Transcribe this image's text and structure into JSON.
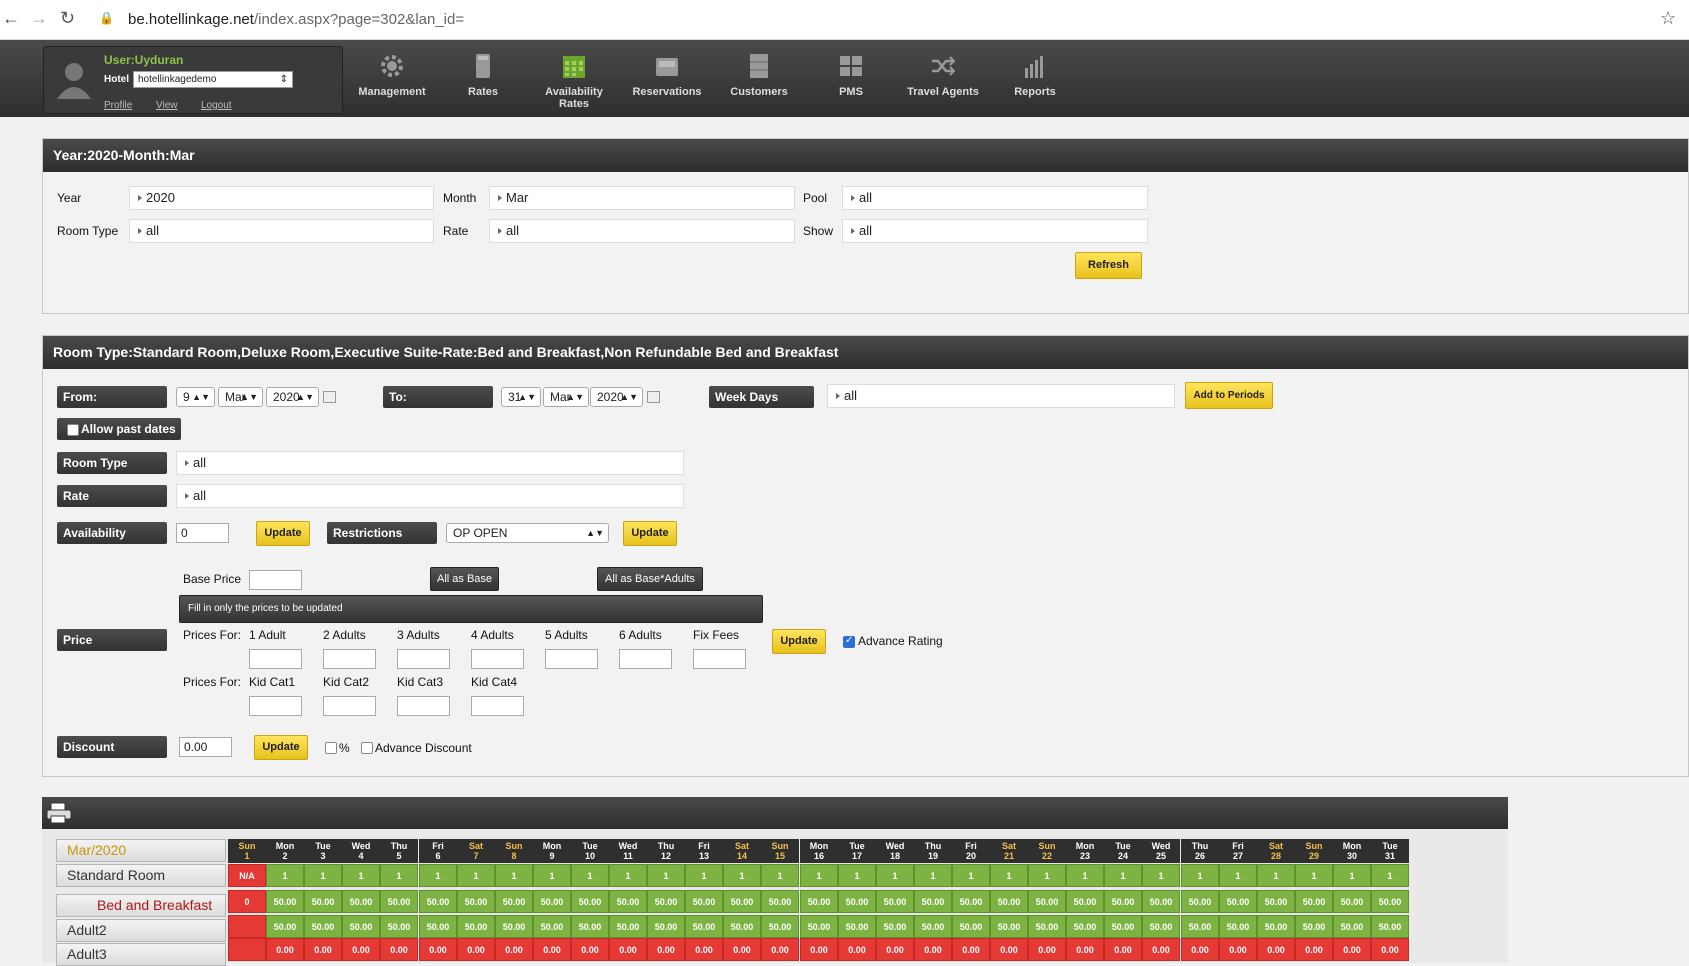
{
  "browser": {
    "url_host": "be.hotellinkage.net",
    "url_path": "/index.aspx?page=302&lan_id="
  },
  "user": {
    "name": "User:Uyduran",
    "hotel_label": "Hotel",
    "hotel_value": "hotellinkagedemo",
    "links": [
      "Profile",
      "View",
      "Logout"
    ]
  },
  "menu": [
    {
      "label": "Management",
      "icon": "gear-icon"
    },
    {
      "label": "Rates",
      "icon": "book-icon"
    },
    {
      "label": "Availability Rates",
      "icon": "calendar-icon"
    },
    {
      "label": "Reservations",
      "icon": "inbox-icon"
    },
    {
      "label": "Customers",
      "icon": "cabinet-icon"
    },
    {
      "label": "PMS",
      "icon": "grid-icon"
    },
    {
      "label": "Travel Agents",
      "icon": "shuffle-icon"
    },
    {
      "label": "Reports",
      "icon": "bar-chart-icon"
    }
  ],
  "filter": {
    "title": "Year:2020-Month:Mar",
    "year_label": "Year",
    "year_value": "2020",
    "month_label": "Month",
    "month_value": "Mar",
    "pool_label": "Pool",
    "pool_value": "all",
    "roomtype_label": "Room Type",
    "roomtype_value": "all",
    "rate_label": "Rate",
    "rate_value": "all",
    "show_label": "Show",
    "show_value": "all",
    "refresh": "Refresh"
  },
  "editor": {
    "title": "Room Type:Standard Room,Deluxe Room,Executive Suite-Rate:Bed and Breakfast,Non Refundable Bed and Breakfast",
    "from_label": "From:",
    "from_day": "9",
    "from_month": "Mar",
    "from_year": "2020",
    "to_label": "To:",
    "to_day": "31",
    "to_month": "Mar",
    "to_year": "2020",
    "weekdays_label": "Week Days",
    "weekdays_value": "all",
    "add_periods": "Add to Periods",
    "allow_past": "Allow past dates",
    "roomtype_label": "Room Type",
    "roomtype_value": "all",
    "rate_label": "Rate",
    "rate_value": "all",
    "availability_label": "Availability",
    "availability_value": "0",
    "update": "Update",
    "restrictions_label": "Restrictions",
    "restrictions_value": "OP OPEN",
    "base_price_label": "Base Price",
    "all_as_base": "All as Base",
    "all_as_base_adults": "All as Base*Adults",
    "hint": "Fill in only the prices to be updated",
    "price_label": "Price",
    "prices_for": "Prices For:",
    "adult_cols": [
      "1 Adult",
      "2 Adults",
      "3 Adults",
      "4 Adults",
      "5 Adults",
      "6 Adults",
      "Fix Fees"
    ],
    "kid_cols": [
      "Kid Cat1",
      "Kid Cat2",
      "Kid Cat3",
      "Kid Cat4"
    ],
    "advance_rating": "Advance Rating",
    "discount_label": "Discount",
    "discount_value": "0.00",
    "percent": "%",
    "advance_discount": "Advance Discount"
  },
  "grid": {
    "month": "Mar/2020",
    "days": [
      {
        "d": "Sun",
        "n": "1"
      },
      {
        "d": "Mon",
        "n": "2"
      },
      {
        "d": "Tue",
        "n": "3"
      },
      {
        "d": "Wed",
        "n": "4"
      },
      {
        "d": "Thu",
        "n": "5"
      },
      {
        "d": "Fri",
        "n": "6"
      },
      {
        "d": "Sat",
        "n": "7"
      },
      {
        "d": "Sun",
        "n": "8"
      },
      {
        "d": "Mon",
        "n": "9"
      },
      {
        "d": "Tue",
        "n": "10"
      },
      {
        "d": "Wed",
        "n": "11"
      },
      {
        "d": "Thu",
        "n": "12"
      },
      {
        "d": "Fri",
        "n": "13"
      },
      {
        "d": "Sat",
        "n": "14"
      },
      {
        "d": "Sun",
        "n": "15"
      },
      {
        "d": "Mon",
        "n": "16"
      },
      {
        "d": "Tue",
        "n": "17"
      },
      {
        "d": "Wed",
        "n": "18"
      },
      {
        "d": "Thu",
        "n": "19"
      },
      {
        "d": "Fri",
        "n": "20"
      },
      {
        "d": "Sat",
        "n": "21"
      },
      {
        "d": "Sun",
        "n": "22"
      },
      {
        "d": "Mon",
        "n": "23"
      },
      {
        "d": "Tue",
        "n": "24"
      },
      {
        "d": "Wed",
        "n": "25"
      },
      {
        "d": "Thu",
        "n": "26"
      },
      {
        "d": "Fri",
        "n": "27"
      },
      {
        "d": "Sat",
        "n": "28"
      },
      {
        "d": "Sun",
        "n": "29"
      },
      {
        "d": "Mon",
        "n": "30"
      },
      {
        "d": "Tue",
        "n": "31"
      }
    ],
    "rows": [
      {
        "label": "Standard Room",
        "first": "N/A",
        "value": "1",
        "first_status": "red",
        "status": "green"
      },
      {
        "label": "Bed and Breakfast",
        "first": "0",
        "value": "50.00",
        "first_status": "red",
        "status": "green"
      },
      {
        "label": "Adult2",
        "first": "",
        "value": "50.00",
        "first_status": "red",
        "status": "green"
      },
      {
        "label": "Adult3",
        "first": "",
        "value": "0.00",
        "first_status": "red",
        "status": "red"
      }
    ],
    "weekend_color": "#f0c24b",
    "green": "#7cb342",
    "red": "#e53935"
  }
}
